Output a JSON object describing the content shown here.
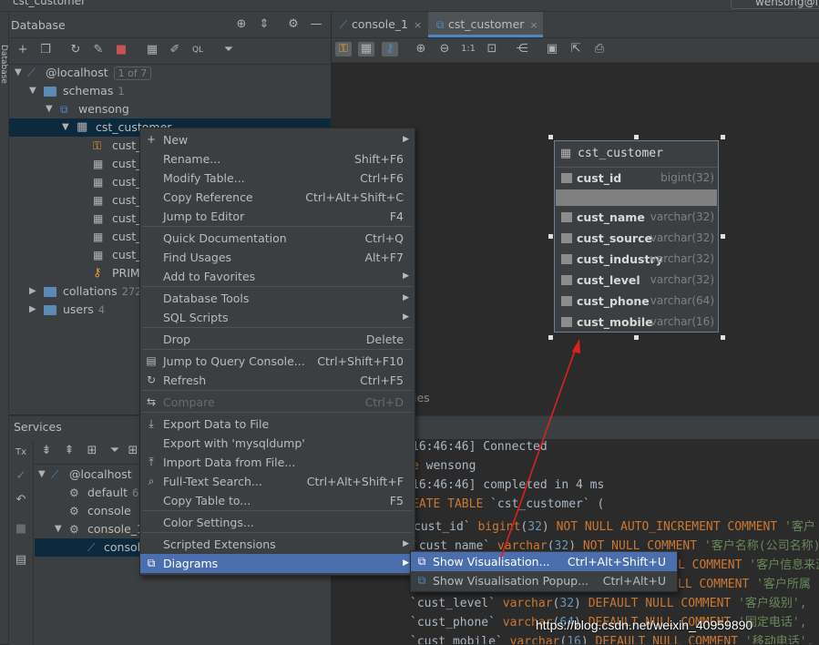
{
  "window": {
    "title": "cst_customer",
    "user_chip": "wensong@l"
  },
  "side_strip": {
    "label": "Database"
  },
  "database_panel": {
    "title": "Database",
    "tree": [
      {
        "label": "@localhost",
        "badge": "1 of 7"
      },
      {
        "label": "schemas",
        "count": "1"
      },
      {
        "label": "wensong"
      },
      {
        "label": "cst_customer"
      },
      {
        "label": "cust_i"
      },
      {
        "label": "cust_n"
      },
      {
        "label": "cust_s"
      },
      {
        "label": "cust_i"
      },
      {
        "label": "cust_l"
      },
      {
        "label": "cust_p"
      },
      {
        "label": "cust_m"
      },
      {
        "label": "PRIM"
      },
      {
        "label": "collations",
        "count": "272"
      },
      {
        "label": "users",
        "count": "4"
      }
    ]
  },
  "services_panel": {
    "title": "Services",
    "tree": [
      {
        "label": "@localhost"
      },
      {
        "label": "default",
        "count": "63"
      },
      {
        "label": "console"
      },
      {
        "label": "console_1"
      },
      {
        "label": "console"
      }
    ]
  },
  "editor_tabs": [
    {
      "label": "console_1",
      "close": "×"
    },
    {
      "label": "cst_customer",
      "close": "×"
    }
  ],
  "diagram_toolbar": {
    "zoom_actual": "1:1"
  },
  "diagram": {
    "table_name": "cst_customer",
    "columns": [
      {
        "name": "cust_id",
        "type": "bigint(32)"
      },
      {
        "name": "cust_name",
        "type": "varchar(32)"
      },
      {
        "name": "cust_source",
        "type": "varchar(32)"
      },
      {
        "name": "cust_industry",
        "type": "varchar(32)"
      },
      {
        "name": "cust_level",
        "type": "varchar(32)"
      },
      {
        "name": "cust_phone",
        "type": "varchar(64)"
      },
      {
        "name": "cust_mobile",
        "type": "varchar(16)"
      }
    ],
    "partial_label": "les"
  },
  "output": {
    "lines": [
      {
        "parts": [
          {
            "t": " 16:46:46] Connected"
          }
        ]
      },
      {
        "parts": [
          {
            "t": "e",
            "c": "kw"
          },
          {
            "t": " wensong"
          }
        ]
      },
      {
        "parts": [
          {
            "t": " 16:46:46] completed in 4 ms"
          }
        ]
      },
      {
        "parts": [
          {
            "t": "EATE TABLE",
            "c": "kw"
          },
          {
            "t": " `cst_customer` ("
          }
        ]
      },
      {
        "parts": [
          {
            "t": "cust_id` "
          },
          {
            "t": "bigint",
            "c": "kw"
          },
          {
            "t": "("
          },
          {
            "t": "32",
            "c": "num"
          },
          {
            "t": ") "
          },
          {
            "t": "NOT NULL AUTO_INCREMENT COMMENT",
            "c": "kw"
          },
          {
            "t": " "
          },
          {
            "t": "'客户",
            "c": "str"
          }
        ]
      },
      {
        "parts": [
          {
            "t": "`cust_name` "
          },
          {
            "t": "varchar",
            "c": "kw"
          },
          {
            "t": "("
          },
          {
            "t": "32",
            "c": "num"
          },
          {
            "t": ") "
          },
          {
            "t": "NOT NULL COMMENT",
            "c": "kw"
          },
          {
            "t": " "
          },
          {
            "t": "'客户名称(公司名称)",
            "c": "str"
          }
        ]
      },
      {
        "parts": [
          {
            "t": "L COMMENT",
            "c": "kw"
          },
          {
            "t": " "
          },
          {
            "t": "'客户信息来源",
            "c": "str"
          }
        ]
      },
      {
        "parts": [
          {
            "t": "LL COMMENT",
            "c": "kw"
          },
          {
            "t": " "
          },
          {
            "t": "'客户所属",
            "c": "str"
          }
        ]
      },
      {
        "parts": [
          {
            "t": "`cust_level` "
          },
          {
            "t": "varchar",
            "c": "kw"
          },
          {
            "t": "("
          },
          {
            "t": "32",
            "c": "num"
          },
          {
            "t": ") "
          },
          {
            "t": "DEFAULT NULL COMMENT",
            "c": "kw"
          },
          {
            "t": " "
          },
          {
            "t": "'客户级别',",
            "c": "str"
          }
        ]
      },
      {
        "parts": [
          {
            "t": "`cust_phone` "
          },
          {
            "t": "varchar",
            "c": "kw"
          },
          {
            "t": "("
          },
          {
            "t": "64",
            "c": "num"
          },
          {
            "t": ") "
          },
          {
            "t": "DEFAULT NULL COMMENT",
            "c": "kw"
          },
          {
            "t": " "
          },
          {
            "t": "'固定电话',",
            "c": "str"
          }
        ]
      },
      {
        "parts": [
          {
            "t": "`cust_mobile` "
          },
          {
            "t": "varchar",
            "c": "kw"
          },
          {
            "t": "("
          },
          {
            "t": "16",
            "c": "num"
          },
          {
            "t": ") "
          },
          {
            "t": "DEFAULT NULL COMMENT",
            "c": "kw"
          },
          {
            "t": " "
          },
          {
            "t": "'移动电话',",
            "c": "str"
          }
        ]
      }
    ]
  },
  "context_menu": {
    "items": [
      {
        "label": "New",
        "submenu": true,
        "icon": "plus-icon"
      },
      {
        "label": "Rename...",
        "shortcut": "Shift+F6"
      },
      {
        "label": "Modify Table...",
        "shortcut": "Ctrl+F6"
      },
      {
        "label": "Copy Reference",
        "shortcut": "Ctrl+Alt+Shift+C"
      },
      {
        "label": "Jump to Editor",
        "shortcut": "F4"
      },
      {
        "label": "Quick Documentation",
        "shortcut": "Ctrl+Q"
      },
      {
        "label": "Find Usages",
        "shortcut": "Alt+F7"
      },
      {
        "label": "Add to Favorites",
        "submenu": true
      },
      {
        "label": "Database Tools",
        "submenu": true
      },
      {
        "label": "SQL Scripts",
        "submenu": true
      },
      {
        "label": "Drop",
        "shortcut": "Delete"
      },
      {
        "label": "Jump to Query Console...",
        "shortcut": "Ctrl+Shift+F10",
        "icon": "query-console-icon"
      },
      {
        "label": "Refresh",
        "shortcut": "Ctrl+F5",
        "icon": "refresh-icon"
      },
      {
        "label": "Compare",
        "shortcut": "Ctrl+D",
        "disabled": true,
        "icon": "compare-icon"
      },
      {
        "label": "Export Data to File",
        "icon": "export-icon"
      },
      {
        "label": "Export with 'mysqldump'"
      },
      {
        "label": "Import Data from File...",
        "icon": "import-icon"
      },
      {
        "label": "Full-Text Search...",
        "shortcut": "Ctrl+Alt+Shift+F",
        "icon": "search-icon"
      },
      {
        "label": "Copy Table to...",
        "shortcut": "F5"
      },
      {
        "label": "Color Settings..."
      },
      {
        "label": "Scripted Extensions",
        "submenu": true
      },
      {
        "label": "Diagrams",
        "submenu": true,
        "selected": true,
        "icon": "diagram-icon"
      }
    ]
  },
  "diagrams_submenu": {
    "items": [
      {
        "label": "Show Visualisation...",
        "shortcut": "Ctrl+Alt+Shift+U",
        "selected": true
      },
      {
        "label": "Show Visualisation Popup...",
        "shortcut": "Ctrl+Alt+U"
      }
    ]
  },
  "watermark": "https://blog.csdn.net/weixin_40959890",
  "colors": {
    "selection": "#4b6eaf",
    "panel": "#3c3f41",
    "editor": "#2b2b2b",
    "arrow": "#e02020"
  }
}
